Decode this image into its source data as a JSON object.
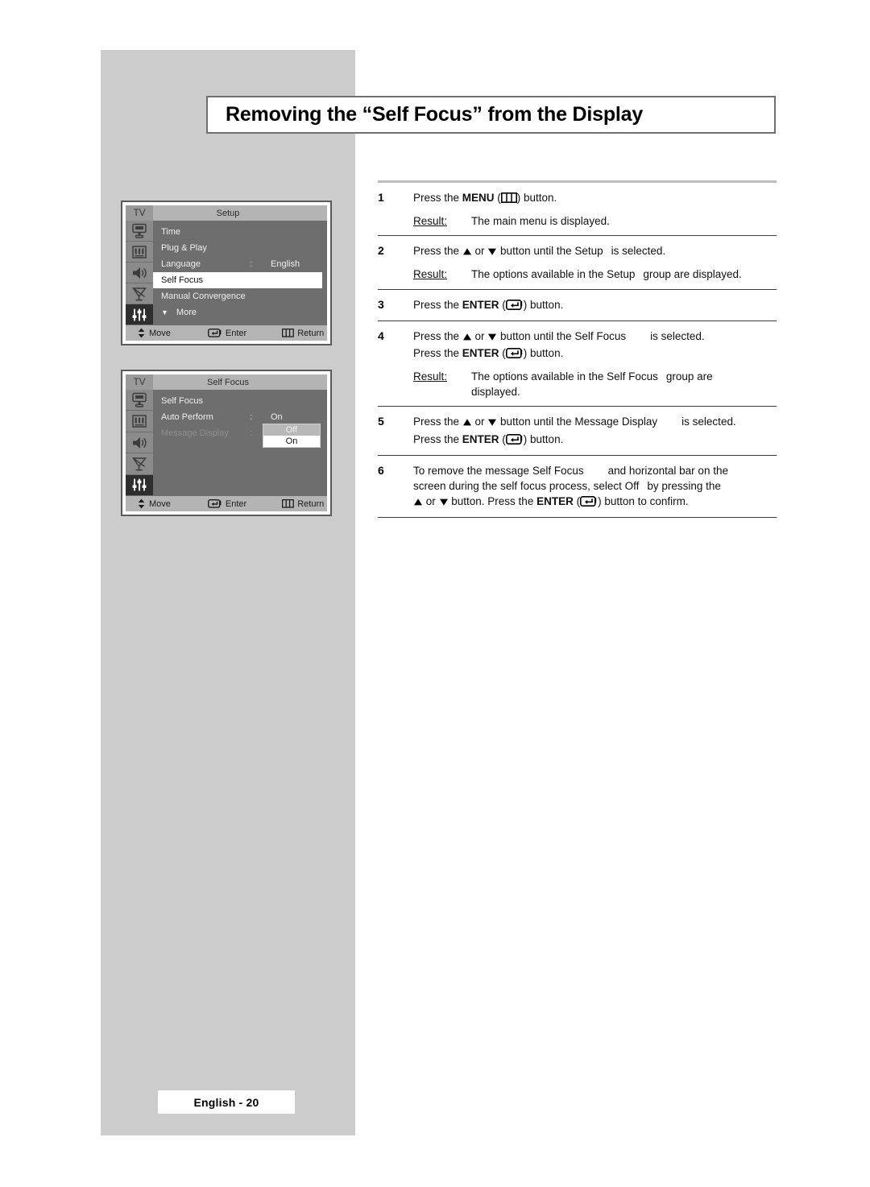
{
  "page": {
    "title": "Removing the “Self Focus” from the Display",
    "footer": "English - 20"
  },
  "osd_menus": [
    {
      "tv_tag": "TV",
      "title": "Setup",
      "rows": [
        {
          "label": "Time",
          "colon": "",
          "value": "",
          "state": "normal"
        },
        {
          "label": "Plug & Play",
          "colon": "",
          "value": "",
          "state": "normal"
        },
        {
          "label": "Language",
          "colon": ":",
          "value": "English",
          "state": "normal"
        },
        {
          "label": "Self Focus",
          "colon": "",
          "value": "",
          "state": "highlight"
        },
        {
          "label": "Manual Convergence",
          "colon": "",
          "value": "",
          "state": "normal"
        },
        {
          "label": "More",
          "colon": "",
          "value": "",
          "state": "more"
        }
      ],
      "statusbar": {
        "move": "Move",
        "enter": "Enter",
        "return": "Return"
      }
    },
    {
      "tv_tag": "TV",
      "title": "Self Focus",
      "rows": [
        {
          "label": "Self Focus",
          "colon": "",
          "value": "",
          "state": "normal"
        },
        {
          "label": "Auto Perform",
          "colon": ":",
          "value": "On",
          "state": "normal"
        },
        {
          "label": "Message Display",
          "colon": ":",
          "value": "",
          "state": "dim"
        }
      ],
      "dropdown": {
        "options": [
          "Off",
          "On"
        ],
        "selected": "On"
      },
      "statusbar": {
        "move": "Move",
        "enter": "Enter",
        "return": "Return"
      }
    }
  ],
  "steps": [
    {
      "num": "1",
      "lines": [
        {
          "parts": [
            {
              "t": "Press the ",
              "bold": false
            },
            {
              "t": "MENU",
              "bold": true
            },
            {
              "t": " (",
              "bold": false
            },
            {
              "icon": "menu-button-icon"
            },
            {
              "t": ") button.",
              "bold": false
            }
          ]
        }
      ],
      "result": {
        "label": "Result:",
        "text": "The main menu is displayed."
      }
    },
    {
      "num": "2",
      "lines": [
        {
          "parts": [
            {
              "t": "Press the ",
              "bold": false
            },
            {
              "icon": "up-arrow-icon"
            },
            {
              "t": " or ",
              "bold": false
            },
            {
              "icon": "down-arrow-icon"
            },
            {
              "t": " button until the Setup",
              "bold": false
            },
            {
              "gap": "sm"
            },
            {
              "t": "is selected.",
              "bold": false
            }
          ]
        }
      ],
      "result": {
        "label": "Result:",
        "text_pre": "The options available in the Setup",
        "text_post": "group are displayed."
      }
    },
    {
      "num": "3",
      "lines": [
        {
          "parts": [
            {
              "t": "Press the ",
              "bold": false
            },
            {
              "t": "ENTER",
              "bold": true
            },
            {
              "t": " (",
              "bold": false
            },
            {
              "icon": "enter-button-icon"
            },
            {
              "t": ") button.",
              "bold": false
            }
          ]
        }
      ],
      "result": null
    },
    {
      "num": "4",
      "lines": [
        {
          "parts": [
            {
              "t": "Press the ",
              "bold": false
            },
            {
              "icon": "up-arrow-icon"
            },
            {
              "t": " or ",
              "bold": false
            },
            {
              "icon": "down-arrow-icon"
            },
            {
              "t": " button until the Self Focus",
              "bold": false
            },
            {
              "gap": "md"
            },
            {
              "t": "is selected.",
              "bold": false
            }
          ]
        },
        {
          "parts": [
            {
              "t": "Press the ",
              "bold": false
            },
            {
              "t": "ENTER",
              "bold": true
            },
            {
              "t": " (",
              "bold": false
            },
            {
              "icon": "enter-button-icon"
            },
            {
              "t": ") button.",
              "bold": false
            }
          ]
        }
      ],
      "result": {
        "label": "Result:",
        "text_pre": "The options available in the Self Focus",
        "text_post": "group are",
        "text_line2": "displayed."
      }
    },
    {
      "num": "5",
      "lines": [
        {
          "parts": [
            {
              "t": "Press the ",
              "bold": false
            },
            {
              "icon": "up-arrow-icon"
            },
            {
              "t": " or ",
              "bold": false
            },
            {
              "icon": "down-arrow-icon"
            },
            {
              "t": " button until the Message Display",
              "bold": false
            },
            {
              "gap": "md"
            },
            {
              "t": "is selected.",
              "bold": false
            }
          ]
        },
        {
          "parts": [
            {
              "t": "Press the ",
              "bold": false
            },
            {
              "t": "ENTER",
              "bold": true
            },
            {
              "t": " (",
              "bold": false
            },
            {
              "icon": "enter-button-icon"
            },
            {
              "t": ") button.",
              "bold": false
            }
          ]
        }
      ],
      "result": null
    },
    {
      "num": "6",
      "lines": [
        {
          "parts": [
            {
              "t": "To remove the message Self Focus",
              "bold": false
            },
            {
              "gap": "md"
            },
            {
              "t": "and horizontal bar on the",
              "bold": false
            }
          ]
        },
        {
          "parts": [
            {
              "t": "screen during the self focus process, select Off",
              "bold": false
            },
            {
              "gap": "sm"
            },
            {
              "t": "by pressing the",
              "bold": false
            }
          ]
        },
        {
          "parts": [
            {
              "icon": "up-arrow-icon"
            },
            {
              "t": " or ",
              "bold": false
            },
            {
              "icon": "down-arrow-icon"
            },
            {
              "t": " button. Press the ",
              "bold": false
            },
            {
              "t": "ENTER",
              "bold": true
            },
            {
              "t": " (",
              "bold": false
            },
            {
              "icon": "enter-button-icon"
            },
            {
              "t": ") button to confirm.",
              "bold": false
            }
          ]
        }
      ],
      "result": null
    }
  ],
  "colors": {
    "page_panel_gray": "#cccccc",
    "osd_body": "#6e6e6e",
    "osd_bar": "#b4b4b4",
    "osd_highlight": "#ffffff",
    "rule_top": "#bdbdbd",
    "rule_step": "#3b3b3b"
  }
}
